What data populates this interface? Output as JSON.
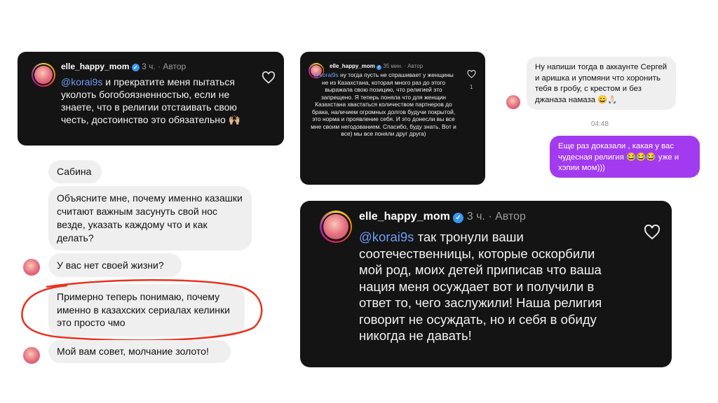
{
  "card1": {
    "username": "elle_happy_mom",
    "time": "3 ч.",
    "separator": "·",
    "author": "Автор",
    "mention": "@korai9s",
    "text": "и прекратите меня пытаться уколоть богобоязненностью, если не знаете, что в религии отстаивать свою честь, достоинство это обязательно",
    "emoji": "🙌🏼"
  },
  "card2": {
    "username": "elle_happy_mom",
    "time": "35 мин.",
    "separator": "·",
    "author": "Автор",
    "mention": "@korai9s",
    "text": "ну тогда пусть не спрашивает у женщины не из Казахстана, которая много раз до этого выражала свою позицию, что религией это запрещено. Я теперь поняла что для женщин Казахстана хвастаться количеством партнеров до брака, наличием огромных долгов будучи покрытой, это норма и проявление себя. И это донесли вы все мне своим негодованием. Спасибо, буду знать. Вот и все) мы все поняли друг друга)",
    "likes": "1"
  },
  "card3": {
    "username": "elle_happy_mom",
    "time": "3 ч.",
    "separator": "·",
    "author": "Автор",
    "mention": "@korai9s",
    "text": "так тронули ваши соотечественницы, которые оскорбили мой род, моих детей приписав что ваша нация меня осуждает вот и получили в ответ то, чего заслужили! Наша религия говорит не осуждать, но и себя в обиду никогда не давать!"
  },
  "dm_right": {
    "incoming": "Ну напиши тогда в аккаунте Сергей и аришка и упомяни что хоронить тебя в гробу, с крестом и без джаназа намаза 😄🙏🏻",
    "time": "04:48",
    "outgoing": "Еще раз доказали , какая у вас чудесная религия 😂😂😂 уже и хэпии мом)))"
  },
  "dm_left": {
    "name": "Сабина",
    "msg1": "Объясните мне, почему именно казашки считают важным засунуть свой нос везде, указать каждому что и как делать?",
    "msg2": "У вас нет своей жизни?",
    "msg3": "Примерно теперь понимаю, почему именно в казахских сериалах келинки это просто чмо",
    "msg4": "Мой вам совет, молчание золото!"
  },
  "colors": {
    "card_bg": "#141414",
    "mention": "#6f9ef7",
    "bubble_gray": "#efefef",
    "bubble_purple": "#a23bf0",
    "highlight_circle": "#e8321e"
  }
}
